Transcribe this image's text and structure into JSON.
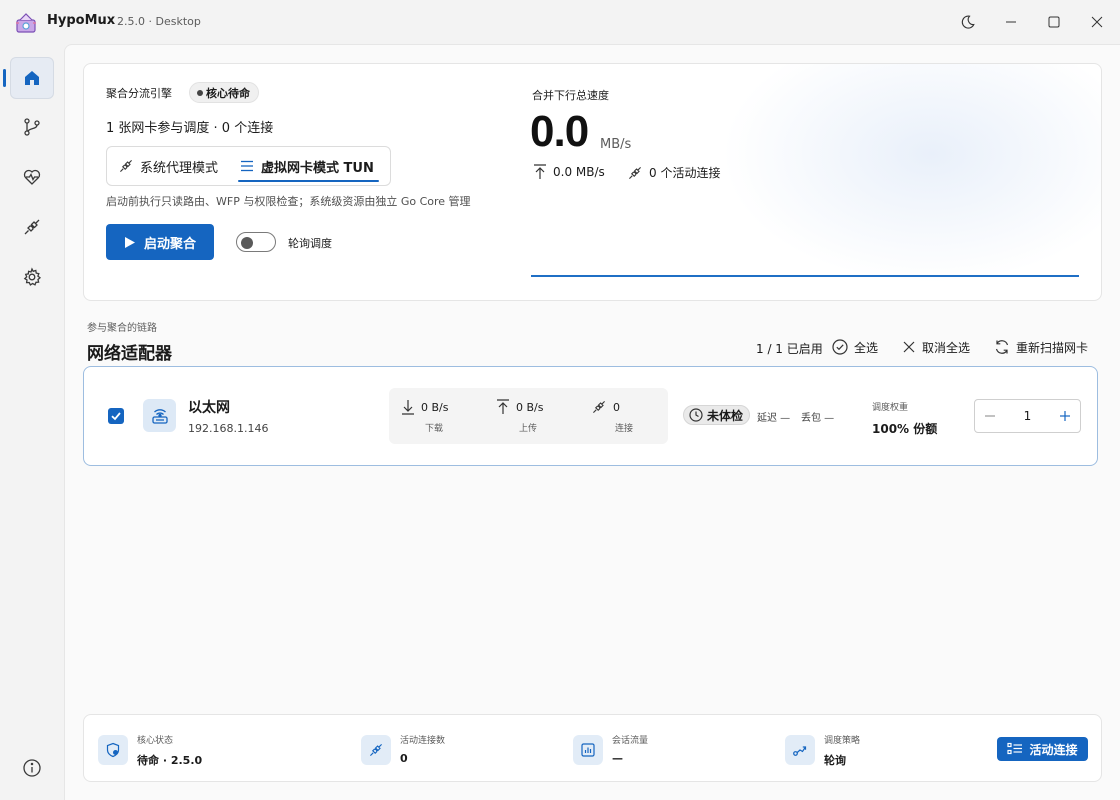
{
  "window": {
    "app_name": "HypoMux",
    "version": "2.5.0 · Desktop"
  },
  "sidebar": {
    "items": [
      {
        "icon": "home-icon",
        "active": true
      },
      {
        "icon": "branch-icon",
        "active": false
      },
      {
        "icon": "health-icon",
        "active": false
      },
      {
        "icon": "plug-icon",
        "active": false
      },
      {
        "icon": "gear-icon",
        "active": false
      },
      {
        "icon": "info-icon",
        "active": false
      }
    ]
  },
  "engine": {
    "label": "聚合分流引擎",
    "state": "核心待命",
    "summary": "1 张网卡参与调度 · 0 个连接",
    "modes": [
      {
        "label": "系统代理模式",
        "selected": false
      },
      {
        "label": "虚拟网卡模式 TUN",
        "selected": true
      }
    ],
    "hint": "启动前执行只读路由、WFP 与权限检查；系统级资源由独立 Go Core 管理",
    "start_label": "启动聚合",
    "polling_label": "轮询调度",
    "polling_on": false
  },
  "speed": {
    "title": "合并下行总速度",
    "value": "0.0",
    "unit": "MB/s",
    "upload": "0.0 MB/s",
    "connections": "0 个活动连接"
  },
  "adapters_section": {
    "subtitle": "参与聚合的链路",
    "title": "网络适配器",
    "enabled_count": "1 / 1 已启用",
    "select_all": "全选",
    "deselect_all": "取消全选",
    "rescan": "重新扫描网卡"
  },
  "adapters": [
    {
      "checked": true,
      "name": "以太网",
      "ip": "192.168.1.146",
      "download": "0 B/s",
      "download_label": "下载",
      "upload": "0 B/s",
      "upload_label": "上传",
      "connections": "0",
      "connections_label": "连接",
      "health": "未体检",
      "latency": "延迟 —",
      "loss": "丢包 —",
      "weight_label": "调度权重",
      "weight_share": "100% 份额",
      "weight_value": "1"
    }
  ],
  "footer": {
    "core_label": "核心状态",
    "core_value": "待命 · 2.5.0",
    "active_conn_label": "活动连接数",
    "active_conn_value": "0",
    "traffic_label": "会话流量",
    "traffic_value": "—",
    "policy_label": "调度策略",
    "policy_value": "轮询",
    "active_btn": "活动连接"
  },
  "colors": {
    "accent": "#1565c0",
    "background": "#f3f3f3"
  }
}
